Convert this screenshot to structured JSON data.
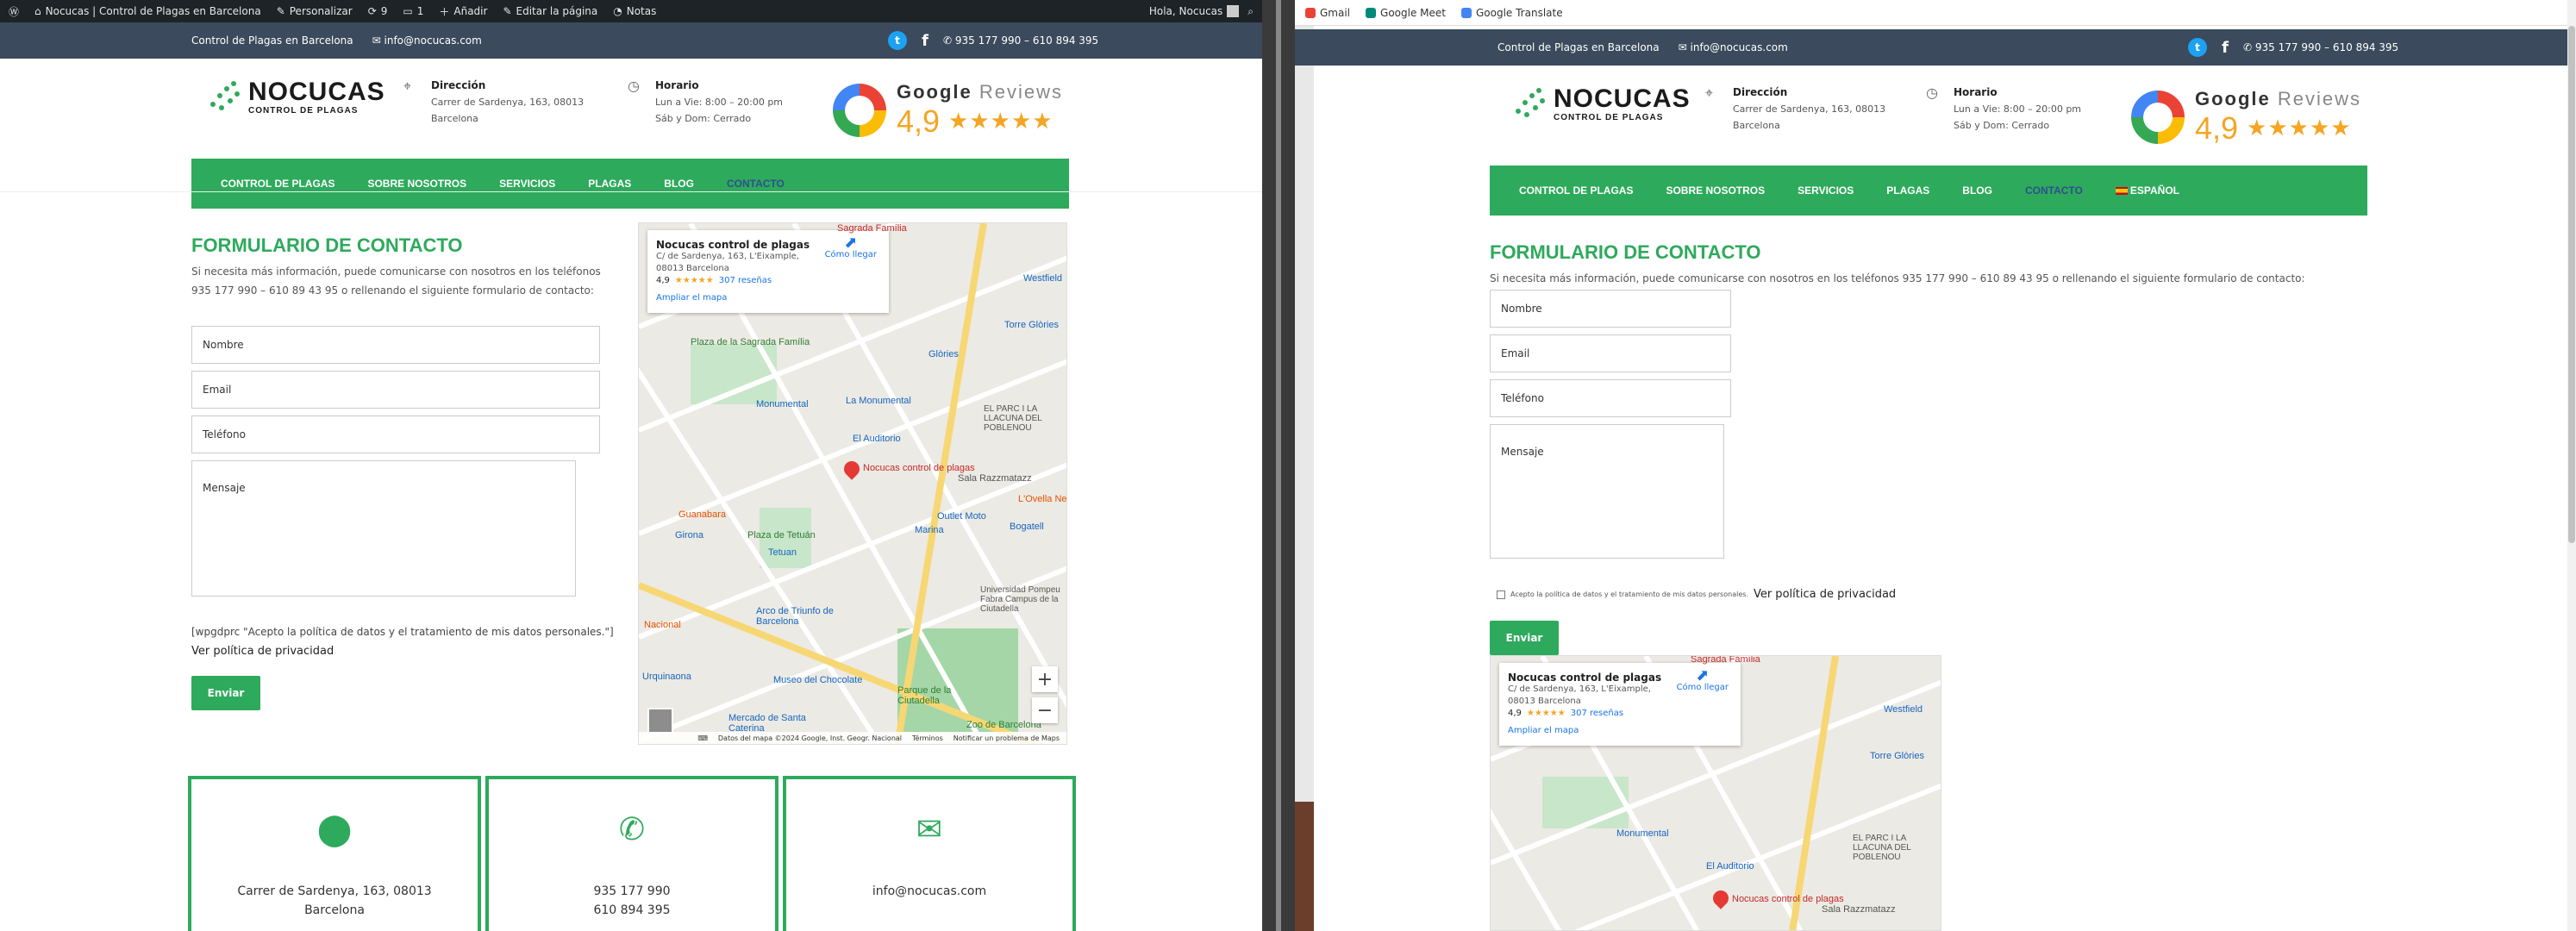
{
  "left": {
    "adminbar": {
      "site": "Nocucas | Control de Plagas en Barcelona",
      "customize": "Personalizar",
      "updates": "9",
      "comments": "1",
      "add": "Añadir",
      "edit": "Editar la página",
      "notes": "Notas",
      "greeting": "Hola, Nocucas"
    }
  },
  "right": {
    "bookmarks": [
      "Gmail",
      "Google Meet",
      "Google Translate"
    ]
  },
  "site": {
    "topbar": {
      "tagline": "Control de Plagas en Barcelona",
      "email": "info@nocucas.com",
      "phones": "935 177 990 – 610 894 395"
    },
    "logo": {
      "brand": "NOCUCAS",
      "sub": "CONTROL DE PLAGAS"
    },
    "direccion": {
      "title": "Dirección",
      "line1": "Carrer de Sardenya, 163, 08013",
      "line2": "Barcelona"
    },
    "horario": {
      "title": "Horario",
      "line1": "Lun a Vie: 8:00 – 20:00 pm",
      "line2": "Sáb y Dom: Cerrado"
    },
    "reviews": {
      "google": "Google",
      "reviews": "Reviews",
      "score": "4,9",
      "stars": "★★★★★"
    },
    "nav": [
      "CONTROL DE PLAGAS",
      "SOBRE NOSOTROS",
      "SERVICIOS",
      "PLAGAS",
      "BLOG",
      "CONTACTO"
    ],
    "nav_lang": "ESPAÑOL",
    "form": {
      "title": "FORMULARIO DE CONTACTO",
      "intro_left_1": "Si necesita más información, puede comunicarse con nosotros en los teléfonos",
      "intro_left_2": "935 177 990 – 610 89 43 95 o rellenando el siguiente formulario de contacto:",
      "intro_right": "Si necesita más información, puede comunicarse con nosotros en los teléfonos 935 177 990 – 610 89 43 95 o rellenando el siguiente formulario de contacto:",
      "name": "Nombre",
      "email": "Email",
      "phone": "Teléfono",
      "message": "Mensaje",
      "shortcode": "[wpgdprc \"Acepto la política de datos y el tratamiento de mis datos personales.\"]",
      "privacy": "Ver política de privacidad",
      "consent": "Acepto la política de datos y el tratamiento de mis datos personales.",
      "submit": "Enviar"
    },
    "map": {
      "name": "Nocucas control de plagas",
      "address1": "C/ de Sardenya, 163, L'Eixample,",
      "address2": "08013 Barcelona",
      "rating": "4,9",
      "stars": "★★★★★",
      "reviews": "307 reseñas",
      "enlarge": "Ampliar el mapa",
      "directions": "Cómo llegar",
      "pin_label": "Nocucas control de plagas",
      "labels": [
        "Sagrada Família",
        "Plaza de la Sagrada Família",
        "Monumental",
        "La Monumental",
        "El Auditorio",
        "EL PARC I LA LLACUNA DEL POBLENOU",
        "Sala Razzmatazz",
        "Torre Glòries",
        "Glòries",
        "Westfield",
        "Guanabara",
        "Girona",
        "Plaza de Tetuán",
        "Tetuan",
        "Outlet Moto",
        "Marina",
        "Bogatell",
        "L'Ovella Ne",
        "Nacional",
        "Arco de Triunfo de Barcelona",
        "Universidad Pompeu Fabra Campus de la Ciutadella",
        "Urquinaona",
        "Museo del Chocolate",
        "Parque de la Ciutadella",
        "Mercado de Santa Caterina",
        "Zoo de Barcelona"
      ],
      "footer": [
        "Datos del mapa ©2024 Google, Inst. Geogr. Nacional",
        "Términos",
        "Notificar un problema de Maps"
      ]
    },
    "contact_boxes": [
      {
        "icon": "location-icon",
        "l1": "Carrer de Sardenya, 163, 08013",
        "l2": "Barcelona"
      },
      {
        "icon": "phone-icon",
        "l1": "935 177 990",
        "l2": "610 894 395"
      },
      {
        "icon": "mail-icon",
        "l1": "info@nocucas.com",
        "l2": ""
      }
    ]
  },
  "colors": {
    "green": "#2eaa5c",
    "topbar": "#3b4a5c",
    "admin": "#1d2327"
  }
}
